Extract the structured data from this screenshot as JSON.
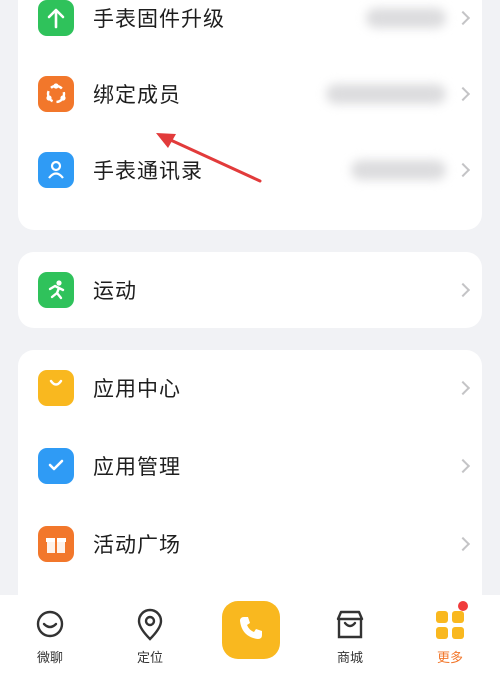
{
  "settings_group_1": {
    "items": [
      {
        "label": "手表固件升级",
        "icon": "up-arrow-icon",
        "color": "#2fc25b"
      },
      {
        "label": "绑定成员",
        "icon": "members-ring-icon",
        "color": "#f2772b"
      },
      {
        "label": "手表通讯录",
        "icon": "contacts-icon",
        "color": "#2f9bf5"
      }
    ]
  },
  "settings_group_2": {
    "items": [
      {
        "label": "运动",
        "icon": "running-person-icon",
        "color": "#2fc25b"
      }
    ]
  },
  "settings_group_3": {
    "items": [
      {
        "label": "应用中心",
        "icon": "shopping-bag-icon",
        "color": "#f9b81f"
      },
      {
        "label": "应用管理",
        "icon": "checkmark-box-icon",
        "color": "#2f9bf5"
      },
      {
        "label": "活动广场",
        "icon": "gift-box-icon",
        "color": "#f2772b"
      }
    ]
  },
  "bottom_nav": {
    "items": [
      {
        "label": "微聊",
        "icon": "chat-bubble-icon"
      },
      {
        "label": "定位",
        "icon": "location-pin-icon"
      },
      {
        "label": "",
        "icon": "phone-icon"
      },
      {
        "label": "商城",
        "icon": "store-icon"
      },
      {
        "label": "更多",
        "icon": "grid-icon"
      }
    ],
    "accent_color": "#f9b81f"
  }
}
